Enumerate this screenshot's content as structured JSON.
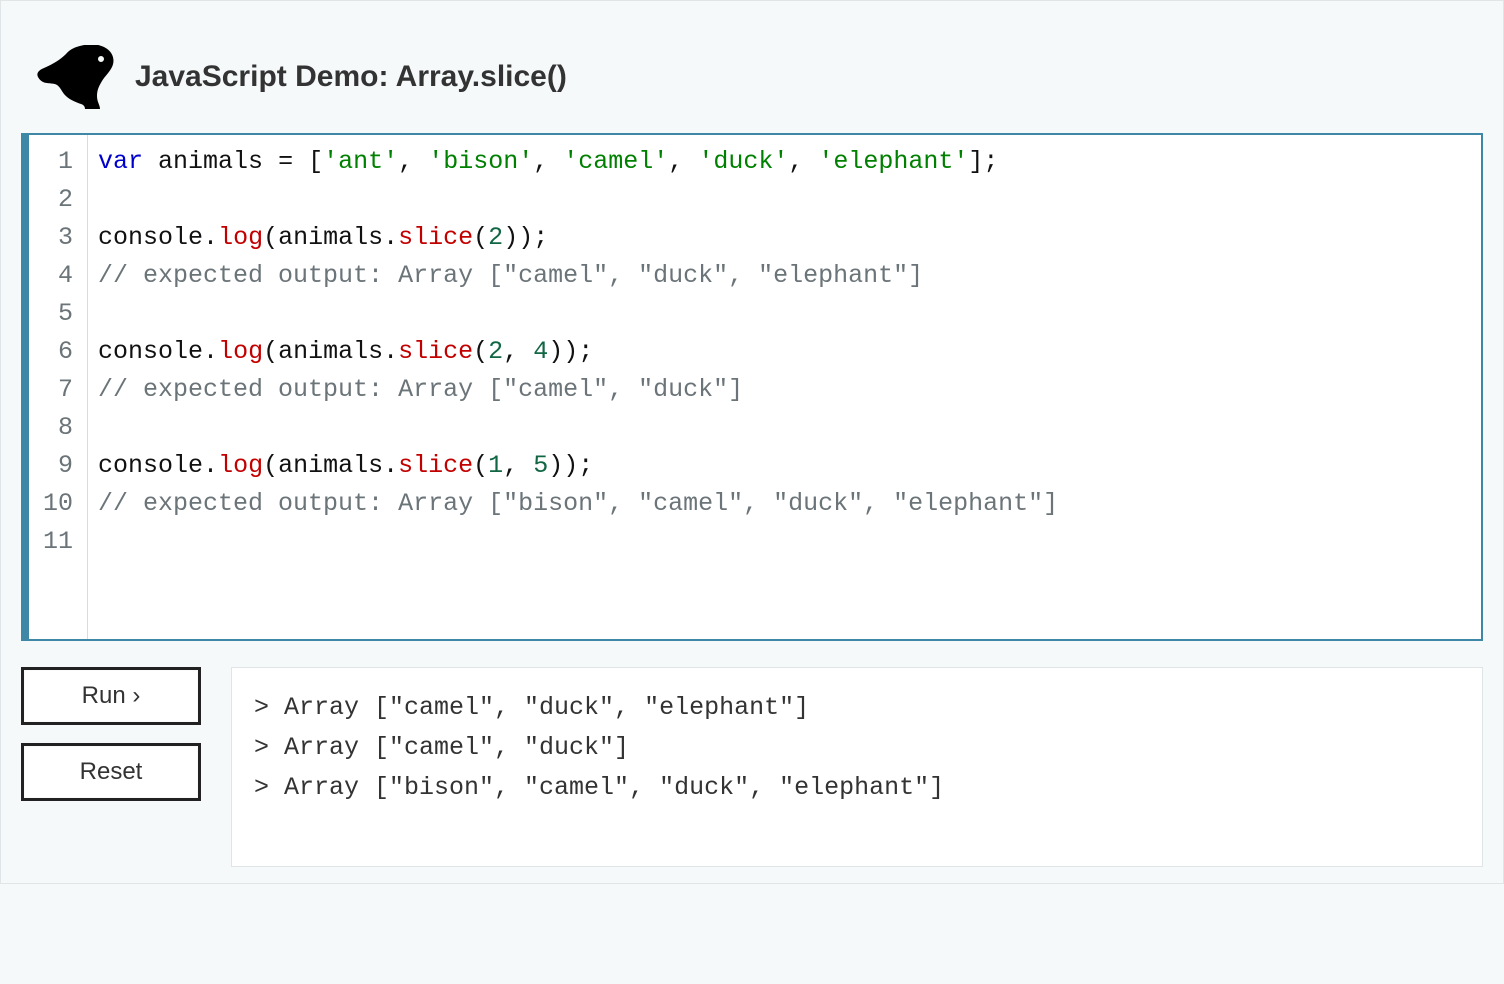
{
  "header": {
    "title": "JavaScript Demo: Array.slice()"
  },
  "editor": {
    "lines": [
      {
        "type": "code",
        "tokens": [
          {
            "cls": "k",
            "t": "var"
          },
          {
            "cls": "",
            "t": " "
          },
          {
            "cls": "id",
            "t": "animals"
          },
          {
            "cls": "",
            "t": " "
          },
          {
            "cls": "op",
            "t": "="
          },
          {
            "cls": "",
            "t": " "
          },
          {
            "cls": "pn",
            "t": "["
          },
          {
            "cls": "str",
            "t": "'ant'"
          },
          {
            "cls": "pn",
            "t": ","
          },
          {
            "cls": "",
            "t": " "
          },
          {
            "cls": "str",
            "t": "'bison'"
          },
          {
            "cls": "pn",
            "t": ","
          },
          {
            "cls": "",
            "t": " "
          },
          {
            "cls": "str",
            "t": "'camel'"
          },
          {
            "cls": "pn",
            "t": ","
          },
          {
            "cls": "",
            "t": " "
          },
          {
            "cls": "str",
            "t": "'duck'"
          },
          {
            "cls": "pn",
            "t": ","
          },
          {
            "cls": "",
            "t": " "
          },
          {
            "cls": "str",
            "t": "'elephant'"
          },
          {
            "cls": "pn",
            "t": "]"
          },
          {
            "cls": "pn",
            "t": ";"
          }
        ]
      },
      {
        "type": "blank"
      },
      {
        "type": "code",
        "tokens": [
          {
            "cls": "id",
            "t": "console"
          },
          {
            "cls": "pn",
            "t": "."
          },
          {
            "cls": "fnred",
            "t": "log"
          },
          {
            "cls": "pn",
            "t": "("
          },
          {
            "cls": "id",
            "t": "animals"
          },
          {
            "cls": "pn",
            "t": "."
          },
          {
            "cls": "fnred",
            "t": "slice"
          },
          {
            "cls": "pn",
            "t": "("
          },
          {
            "cls": "num",
            "t": "2"
          },
          {
            "cls": "pn",
            "t": ")"
          },
          {
            "cls": "pn",
            "t": ")"
          },
          {
            "cls": "pn",
            "t": ";"
          }
        ]
      },
      {
        "type": "comment",
        "text": "// expected output: Array [\"camel\", \"duck\", \"elephant\"]"
      },
      {
        "type": "blank"
      },
      {
        "type": "code",
        "tokens": [
          {
            "cls": "id",
            "t": "console"
          },
          {
            "cls": "pn",
            "t": "."
          },
          {
            "cls": "fnred",
            "t": "log"
          },
          {
            "cls": "pn",
            "t": "("
          },
          {
            "cls": "id",
            "t": "animals"
          },
          {
            "cls": "pn",
            "t": "."
          },
          {
            "cls": "fnred",
            "t": "slice"
          },
          {
            "cls": "pn",
            "t": "("
          },
          {
            "cls": "num",
            "t": "2"
          },
          {
            "cls": "pn",
            "t": ","
          },
          {
            "cls": "",
            "t": " "
          },
          {
            "cls": "num",
            "t": "4"
          },
          {
            "cls": "pn",
            "t": ")"
          },
          {
            "cls": "pn",
            "t": ")"
          },
          {
            "cls": "pn",
            "t": ";"
          }
        ]
      },
      {
        "type": "comment",
        "text": "// expected output: Array [\"camel\", \"duck\"]"
      },
      {
        "type": "blank"
      },
      {
        "type": "code",
        "tokens": [
          {
            "cls": "id",
            "t": "console"
          },
          {
            "cls": "pn",
            "t": "."
          },
          {
            "cls": "fnred",
            "t": "log"
          },
          {
            "cls": "pn",
            "t": "("
          },
          {
            "cls": "id",
            "t": "animals"
          },
          {
            "cls": "pn",
            "t": "."
          },
          {
            "cls": "fnred",
            "t": "slice"
          },
          {
            "cls": "pn",
            "t": "("
          },
          {
            "cls": "num",
            "t": "1"
          },
          {
            "cls": "pn",
            "t": ","
          },
          {
            "cls": "",
            "t": " "
          },
          {
            "cls": "num",
            "t": "5"
          },
          {
            "cls": "pn",
            "t": ")"
          },
          {
            "cls": "pn",
            "t": ")"
          },
          {
            "cls": "pn",
            "t": ";"
          }
        ]
      },
      {
        "type": "comment",
        "text": "// expected output: Array [\"bison\", \"camel\", \"duck\", \"elephant\"]"
      },
      {
        "type": "blank"
      }
    ]
  },
  "buttons": {
    "run": "Run ›",
    "reset": "Reset"
  },
  "console": {
    "rows": [
      "> Array [\"camel\", \"duck\", \"elephant\"]",
      "> Array [\"camel\", \"duck\"]",
      "> Array [\"bison\", \"camel\", \"duck\", \"elephant\"]"
    ]
  }
}
